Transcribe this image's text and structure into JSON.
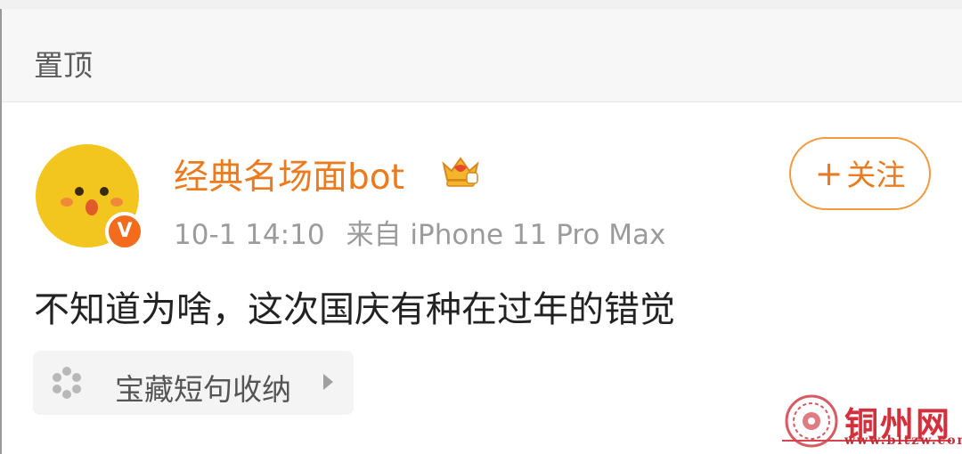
{
  "section": {
    "title": "置顶"
  },
  "post": {
    "username": "经典名场面bot",
    "time": "10-1 14:10",
    "source": "来自 iPhone 11 Pro Max",
    "text": "不知道为啥，这次国庆有种在过年的错觉",
    "verified_badge": "V",
    "follow": {
      "plus": "+",
      "label": "关注"
    },
    "topic": {
      "label": "宝藏短句收纳"
    }
  },
  "watermark": {
    "name": "铜州网",
    "url": "www.bltzw.com"
  },
  "colors": {
    "accent": "#ec7a1f",
    "badge": "#f36b1c",
    "watermark": "#d52f3b"
  },
  "icons": [
    "crown-icon",
    "verified-badge-icon",
    "topic-icon",
    "chevron-right-icon",
    "watermark-logo-icon"
  ]
}
